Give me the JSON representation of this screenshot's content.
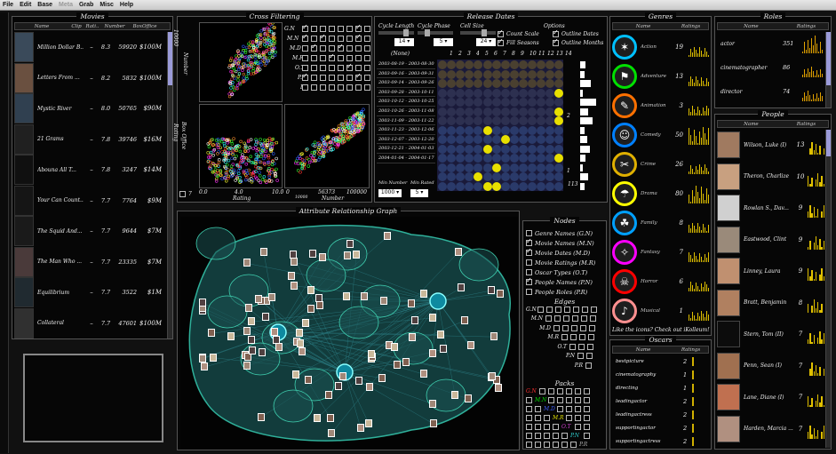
{
  "menu": [
    "File",
    "Edit",
    "Base",
    "Meta",
    "Grab",
    "Misc",
    "Help"
  ],
  "movies": {
    "title": "Movies",
    "headers": [
      "Name",
      "Clip",
      "Rati..",
      "Number",
      "BoxOffice"
    ],
    "rows": [
      {
        "name": "Million Dollar B...",
        "clip": "–",
        "rating": "8.3",
        "number": "59920",
        "box": "$100M"
      },
      {
        "name": "Letters From ...",
        "clip": "–",
        "rating": "8.2",
        "number": "5832",
        "box": "$100M"
      },
      {
        "name": "Mystic River",
        "clip": "–",
        "rating": "8.0",
        "number": "50765",
        "box": "$90M"
      },
      {
        "name": "21 Grams",
        "clip": "–",
        "rating": "7.8",
        "number": "39746",
        "box": "$16M"
      },
      {
        "name": "Abouna All T...",
        "clip": "–",
        "rating": "7.8",
        "number": "3247",
        "box": "$14M"
      },
      {
        "name": "Your Can Count...",
        "clip": "–",
        "rating": "7.7",
        "number": "7764",
        "box": "$9M"
      },
      {
        "name": "The Squid And...",
        "clip": "–",
        "rating": "7.7",
        "number": "9644",
        "box": "$7M"
      },
      {
        "name": "The Man Who ...",
        "clip": "–",
        "rating": "7.7",
        "number": "23335",
        "box": "$7M"
      },
      {
        "name": "Equilibrium",
        "clip": "–",
        "rating": "7.7",
        "number": "3522",
        "box": "$1M"
      },
      {
        "name": "Collateral",
        "clip": "–",
        "rating": "7.7",
        "number": "47601",
        "box": "$100M"
      }
    ]
  },
  "cross": {
    "title": "Cross Filtering",
    "left_axis_labels": [
      "10000",
      "Number",
      "Rating",
      "Box Office"
    ],
    "rating_axis": [
      "0.0",
      "4.0",
      "10.0"
    ],
    "number_axis": [
      "0",
      "10000",
      "56373",
      "100000"
    ],
    "bottom_label_rating": "Rating",
    "bottom_label_number": "Number",
    "matrix_rows": [
      "G.N",
      "M.N",
      "M.D",
      "M.R",
      "O.T",
      "P.N",
      "P.R"
    ],
    "bottom_check_label": "7"
  },
  "release": {
    "title": "Release Dates",
    "controls": [
      "Cycle Length",
      "Cycle Phase",
      "Cell Size"
    ],
    "spin_values": [
      "14",
      "5",
      "24"
    ],
    "options_title": "Options",
    "options": [
      "Count Scale",
      "Outline Dates",
      "Fill Seasons",
      "Outline Months"
    ],
    "none_label": "(None)",
    "columns": [
      "1",
      "2",
      "3",
      "4",
      "5",
      "6",
      "7",
      "8",
      "9",
      "10",
      "11",
      "12",
      "13",
      "14"
    ],
    "dates": [
      "2003-08-19 - 2003-08-30",
      "2003-09-16 - 2003-09-31",
      "2003-09-14 - 2003-09-26",
      "2003-09-28 - 2003-10-11",
      "2003-10-12 - 2003-10-25",
      "2003-10-26 - 2003-11-08",
      "2003-11-09 - 2003-11-22",
      "2003-11-23 - 2003-12-06",
      "2003-12-07 - 2003-12-20",
      "2003-12-21 - 2004-01-03",
      "2004-01-04 - 2004-01-17"
    ],
    "min_number_label": "Min Number",
    "min_rated_label": "Min Rated",
    "min_number": "1000",
    "min_rated": "5",
    "count_label": "113",
    "side_counts": [
      "2",
      "1"
    ]
  },
  "genres": {
    "title": "Genres",
    "headers": [
      "Name",
      "Ratings"
    ],
    "rows": [
      {
        "name": "Action",
        "count": "19",
        "color": "#00c0ff"
      },
      {
        "name": "Adventure",
        "count": "13",
        "color": "#00e000"
      },
      {
        "name": "Animation",
        "count": "3",
        "color": "#ff7000"
      },
      {
        "name": "Comedy",
        "count": "50",
        "color": "#0080ff"
      },
      {
        "name": "Crime",
        "count": "26",
        "color": "#e0b000"
      },
      {
        "name": "Drama",
        "count": "80",
        "color": "#ffff00"
      },
      {
        "name": "Family",
        "count": "8",
        "color": "#00a0ff"
      },
      {
        "name": "Fantasy",
        "count": "7",
        "color": "#ff00ff"
      },
      {
        "name": "Horror",
        "count": "6",
        "color": "#ff0000"
      },
      {
        "name": "Musical",
        "count": "1",
        "color": "#ff9090"
      }
    ],
    "note": "Like the icons? Check out iKolleum!"
  },
  "roles": {
    "title": "Roles",
    "headers": [
      "Name",
      "Ratings"
    ],
    "rows": [
      {
        "name": "actor",
        "count": "351"
      },
      {
        "name": "cinematographer",
        "count": "86"
      },
      {
        "name": "director",
        "count": "74"
      }
    ]
  },
  "people": {
    "title": "People",
    "headers": [
      "Name",
      "Ratings"
    ],
    "rows": [
      {
        "name": "Wilson, Luke (I)",
        "count": "13"
      },
      {
        "name": "Theron, Charlize",
        "count": "10"
      },
      {
        "name": "Rowlan S., Dav...",
        "count": "9"
      },
      {
        "name": "Eastwood, Clint",
        "count": "9"
      },
      {
        "name": "Linney, Laura",
        "count": "9"
      },
      {
        "name": "Bratt, Benjamin",
        "count": "8"
      },
      {
        "name": "Stern, Tom (II)",
        "count": "7"
      },
      {
        "name": "Penn, Sean (I)",
        "count": "7"
      },
      {
        "name": "Lane, Diane (I)",
        "count": "7"
      },
      {
        "name": "Harden, Marcia ...",
        "count": "7"
      }
    ]
  },
  "oscars": {
    "title": "Oscars",
    "headers": [
      "Name",
      "Ratings"
    ],
    "rows": [
      {
        "name": "bestpicture",
        "count": "2"
      },
      {
        "name": "cinematography",
        "count": "1"
      },
      {
        "name": "directing",
        "count": "1"
      },
      {
        "name": "leadingactor",
        "count": "2"
      },
      {
        "name": "leadingactress",
        "count": "2"
      },
      {
        "name": "supportingactor",
        "count": "2"
      },
      {
        "name": "supportingactress",
        "count": "2"
      }
    ]
  },
  "graph": {
    "title": "Attribute Relationship Graph"
  },
  "nodes": {
    "title": "Nodes",
    "items": [
      {
        "label": "Genre Names (G.N)",
        "checked": false
      },
      {
        "label": "Movie Names (M.N)",
        "checked": true
      },
      {
        "label": "Movie Dates (M.D)",
        "checked": true
      },
      {
        "label": "Movie Ratings (M.R)",
        "checked": false
      },
      {
        "label": "Oscar Types (O.T)",
        "checked": false
      },
      {
        "label": "People Names (P.N)",
        "checked": true
      },
      {
        "label": "People Roles (P.R)",
        "checked": false
      }
    ]
  },
  "edges": {
    "title": "Edges",
    "rows": [
      "G.N",
      "M.N",
      "M.D",
      "M.R",
      "O.T",
      "P.N",
      "P.R"
    ]
  },
  "packs": {
    "title": "Packs",
    "labels": [
      "G.N",
      "M.N",
      "M.D",
      "M.R",
      "O.T",
      "P.N",
      "P.R"
    ],
    "colors": [
      "#ff3030",
      "#00e000",
      "#4060ff",
      "#e0e000",
      "#d040d0",
      "#30d0d0",
      "#aaaaaa"
    ]
  }
}
